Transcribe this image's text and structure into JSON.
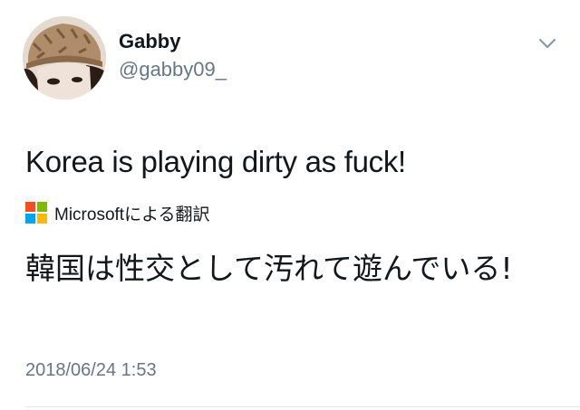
{
  "tweet": {
    "author": {
      "display_name": "Gabby",
      "handle": "@gabby09_",
      "avatar_icon": "profile-photo"
    },
    "menu_icon": "chevron-down-icon",
    "text": "Korea is playing dirty as fuck!",
    "translation": {
      "provider_logo": "microsoft-logo",
      "label": "Microsoftによる翻訳",
      "text": "韓国は性交として汚れて遊んでいる!"
    },
    "timestamp": "2018/06/24 1:53"
  },
  "colors": {
    "text_primary": "#14171a",
    "text_secondary": "#657786",
    "divider": "#e1e8ed",
    "ms_red": "#f25022",
    "ms_green": "#7fba00",
    "ms_blue": "#00a4ef",
    "ms_yellow": "#ffb900"
  }
}
